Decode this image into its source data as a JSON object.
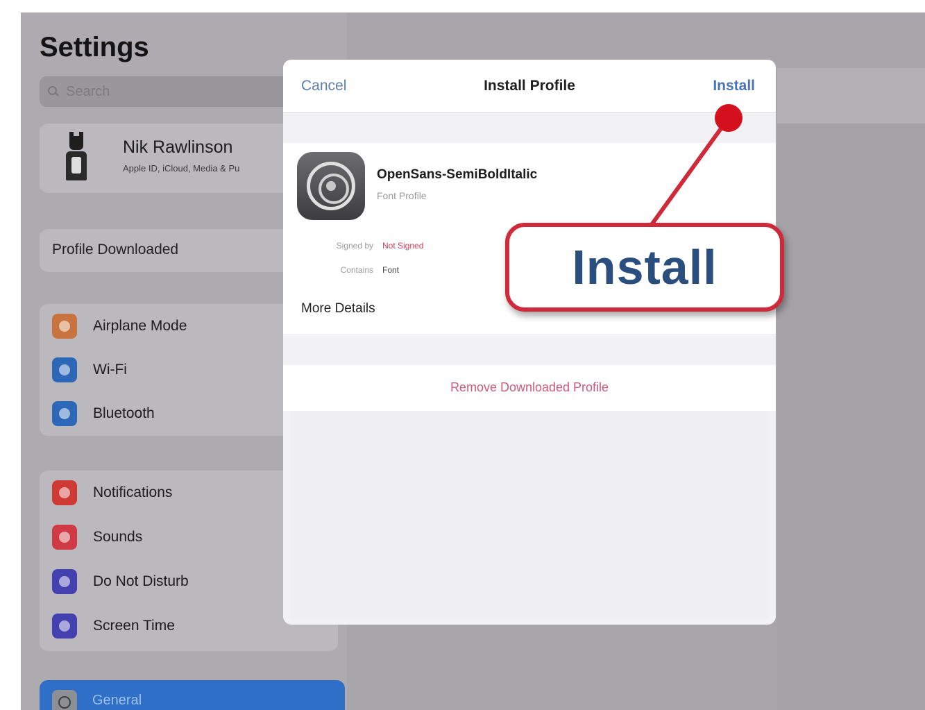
{
  "sidebar": {
    "title": "Settings",
    "search_placeholder": "Search",
    "account": {
      "name": "Nik Rawlinson",
      "subtitle": "Apple ID, iCloud, Media & Pu"
    },
    "notice": "Profile Downloaded",
    "group1": [
      {
        "label": "Airplane Mode",
        "icon": "airplane-icon",
        "color": "#c9733f"
      },
      {
        "label": "Wi-Fi",
        "icon": "wifi-icon",
        "color": "#2d67b8"
      },
      {
        "label": "Bluetooth",
        "icon": "bluetooth-icon",
        "color": "#2d67b8"
      }
    ],
    "group2": [
      {
        "label": "Notifications",
        "icon": "notifications-icon",
        "color": "#cf3a35"
      },
      {
        "label": "Sounds",
        "icon": "sounds-icon",
        "color": "#cf3a45"
      },
      {
        "label": "Do Not Disturb",
        "icon": "moon-icon",
        "color": "#4540b0"
      },
      {
        "label": "Screen Time",
        "icon": "hourglass-icon",
        "color": "#4540b0"
      }
    ],
    "selected": {
      "label": "General",
      "icon": "gear-icon"
    }
  },
  "modal": {
    "cancel_label": "Cancel",
    "title": "Install Profile",
    "install_label": "Install",
    "profile_name": "OpenSans-SemiBoldItalic",
    "profile_type": "Font Profile",
    "signed_by_label": "Signed by",
    "signed_by_value": "Not Signed",
    "contains_label": "Contains",
    "contains_value": "Font",
    "more_details": "More Details",
    "remove_label": "Remove Downloaded Profile"
  },
  "callout": {
    "text": "Install"
  },
  "colors": {
    "accent_blue": "#4a76b7",
    "callout_red": "#cf2a3a",
    "remove_pink": "#cc5a7a",
    "not_signed_red": "#d0405c"
  }
}
